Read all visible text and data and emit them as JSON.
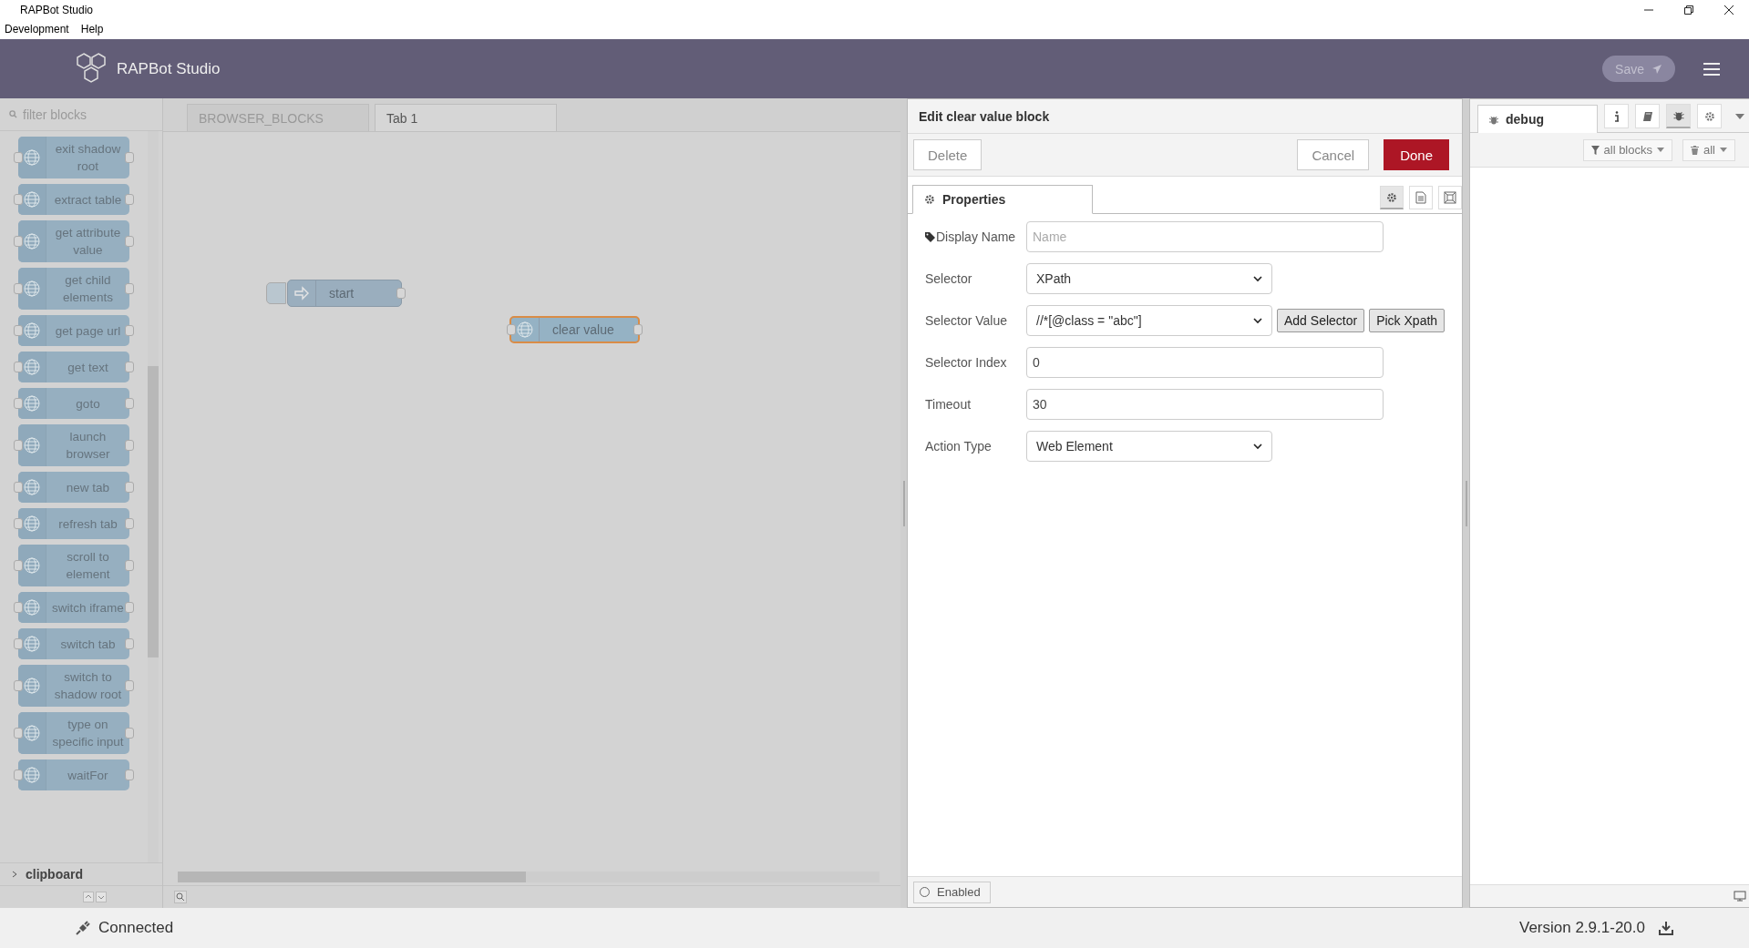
{
  "window": {
    "title": "RAPBot Studio",
    "menu": [
      "Development",
      "Help"
    ]
  },
  "header": {
    "app_name": "RAPBot Studio",
    "save_label": "Save",
    "save_disabled": true
  },
  "palette": {
    "filter_placeholder": "filter blocks",
    "blocks": [
      {
        "label": "exit shadow root"
      },
      {
        "label": "extract table"
      },
      {
        "label": "get attribute value"
      },
      {
        "label": "get child elements"
      },
      {
        "label": "get page url"
      },
      {
        "label": "get text"
      },
      {
        "label": "goto"
      },
      {
        "label": "launch browser"
      },
      {
        "label": "new tab"
      },
      {
        "label": "refresh tab"
      },
      {
        "label": "scroll to element"
      },
      {
        "label": "switch iframe"
      },
      {
        "label": "switch tab"
      },
      {
        "label": "switch to shadow root"
      },
      {
        "label": "type on specific input"
      },
      {
        "label": "waitFor"
      }
    ],
    "category": {
      "label": "clipboard",
      "expanded": false
    }
  },
  "canvas": {
    "tabs": [
      {
        "label": "BROWSER_BLOCKS",
        "selected": false
      },
      {
        "label": "Tab 1",
        "selected": true
      }
    ],
    "nodes": [
      {
        "label": "start",
        "kind": "inject",
        "selected": false
      },
      {
        "label": "clear value",
        "kind": "web",
        "selected": true
      }
    ]
  },
  "editor": {
    "title": "Edit clear value block",
    "delete": "Delete",
    "cancel": "Cancel",
    "done": "Done",
    "tab": "Properties",
    "side_tabs": [
      {
        "kind": "settings",
        "selected": true
      },
      {
        "kind": "description",
        "selected": false
      },
      {
        "kind": "appearance",
        "selected": false
      }
    ],
    "fields": [
      {
        "label": "Display Name",
        "kind": "input",
        "placeholder": "Name",
        "tag_icon": true
      },
      {
        "label": "Selector",
        "kind": "select",
        "value": "XPath"
      },
      {
        "label": "Selector Value",
        "kind": "select",
        "value": "//*[@class = \"abc\"]",
        "buttons": [
          "Add Selector",
          "Pick Xpath"
        ]
      },
      {
        "label": "Selector Index",
        "kind": "input",
        "value": "0"
      },
      {
        "label": "Timeout",
        "kind": "input",
        "value": "30"
      },
      {
        "label": "Action Type",
        "kind": "select",
        "value": "Web Element"
      }
    ],
    "enabled": {
      "label": "Enabled",
      "checked": false
    }
  },
  "sidebar": {
    "tab": "debug",
    "icons": [
      {
        "kind": "info",
        "selected": false
      },
      {
        "kind": "book",
        "selected": false
      },
      {
        "kind": "debug",
        "selected": true
      },
      {
        "kind": "settings",
        "selected": false
      }
    ],
    "filter": "all blocks",
    "clear": "all"
  },
  "status_bar": {
    "connection": "Connected",
    "version": "Version 2.9.1-20.0"
  }
}
